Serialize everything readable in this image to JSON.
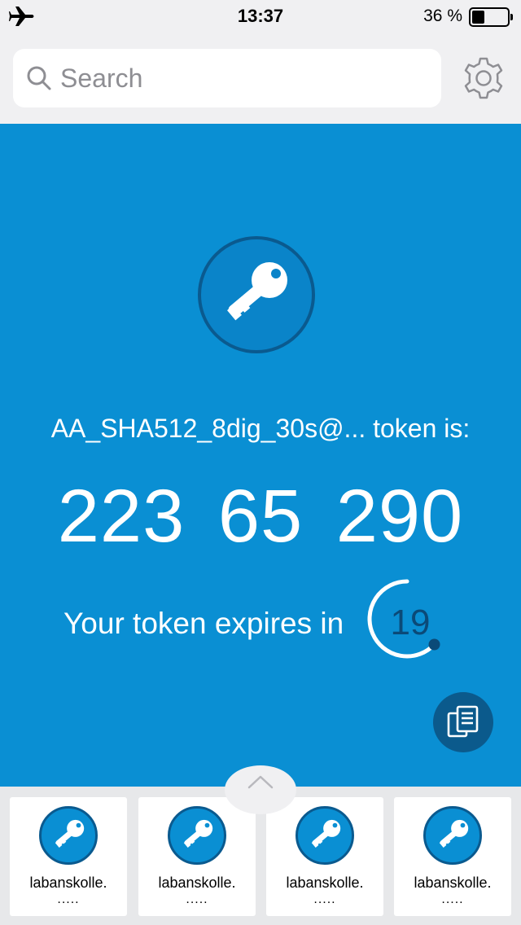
{
  "status_bar": {
    "time": "13:37",
    "battery_text": "36 %",
    "battery_level": 0.36,
    "airplane_icon": "airplane-icon"
  },
  "search": {
    "placeholder": "Search",
    "value": "",
    "icon": "search-icon"
  },
  "settings": {
    "icon": "gear-icon"
  },
  "token": {
    "icon": "key-icon",
    "label": "AA_SHA512_8dig_30s@... token is:",
    "code": "223 65 290",
    "expires_label": "Your token expires in",
    "seconds_left": "19",
    "countdown_fraction": 0.63
  },
  "actions": {
    "copy_icon": "copy-icon"
  },
  "drawer": {
    "handle_icon": "chevron-up-icon",
    "accounts": [
      {
        "name": "labanskolle.",
        "dots": "....."
      },
      {
        "name": "labanskolle.",
        "dots": "....."
      },
      {
        "name": "labanskolle.",
        "dots": "....."
      },
      {
        "name": "labanskolle.",
        "dots": "....."
      }
    ]
  },
  "colors": {
    "primary": "#0a8fd3",
    "primary_dark": "#0a5a8f",
    "background": "#f0f0f2"
  }
}
